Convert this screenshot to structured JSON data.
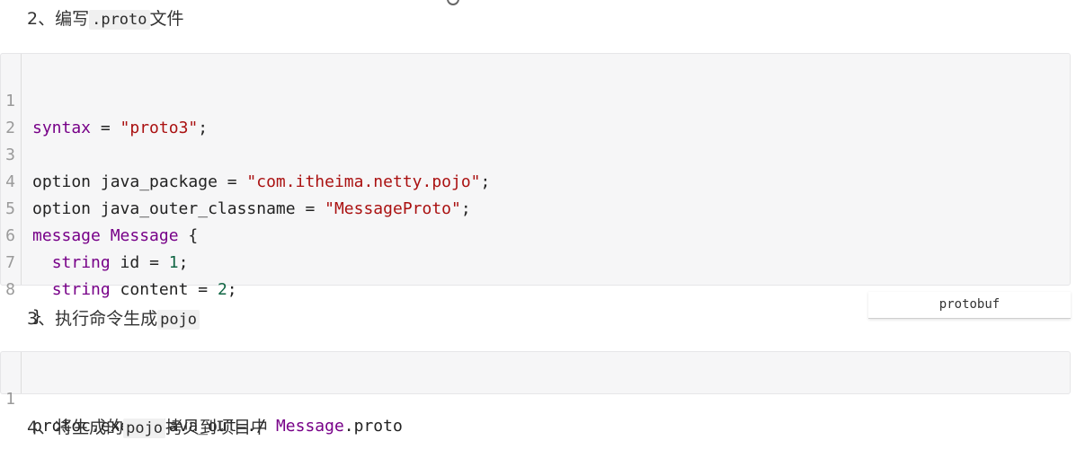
{
  "step2": {
    "num": "2、编写",
    "code": ".proto",
    "suffix": "文件"
  },
  "step3": {
    "num": "3、执行命令生成",
    "code": "pojo"
  },
  "step4": {
    "num": "4、将生成的",
    "code": "pojo",
    "suffix": "拷贝到项目中"
  },
  "proto_block": {
    "line_numbers": [
      "1",
      "2",
      "3",
      "4",
      "5",
      "6",
      "7",
      "8"
    ],
    "line1": {
      "kw": "syntax",
      "op": " = ",
      "str": "\"proto3\"",
      "end": ";"
    },
    "line3": {
      "kw": "option java_package",
      "op": " = ",
      "str": "\"com.itheima.netty.pojo\"",
      "end": ";"
    },
    "line4": {
      "kw": "option java_outer_classname",
      "op": " = ",
      "str": "\"MessageProto\"",
      "end": ";"
    },
    "line5": {
      "kw": "message",
      "name": "Message",
      "brace": " {"
    },
    "line6": {
      "type": "string",
      "field": " id = ",
      "num": "1",
      "end": ";"
    },
    "line7": {
      "type": "string",
      "field": " content = ",
      "num": "2",
      "end": ";"
    },
    "line8": {
      "brace": "}"
    }
  },
  "cmd_block": {
    "line_number": "1",
    "part1": "protoc.exe --java_out=./ ",
    "part2": "Message",
    "part3": ".proto"
  },
  "tooltip": {
    "label": "protobuf"
  }
}
